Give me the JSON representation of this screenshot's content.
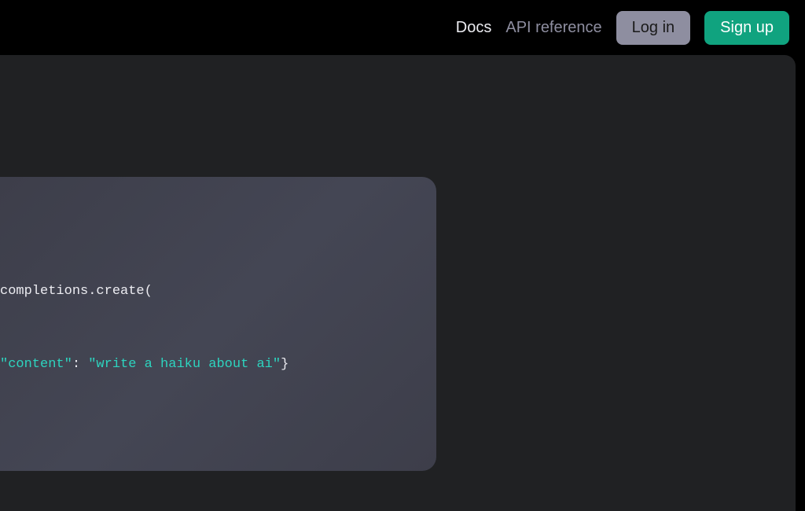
{
  "header": {
    "nav": {
      "docs": "Docs",
      "api_reference": "API reference"
    },
    "login_label": "Log in",
    "signup_label": "Sign up"
  },
  "code": {
    "line1_text": "completions.create(",
    "line2_str1": "\"content\"",
    "line2_colon": ": ",
    "line2_str2": "\"write a haiku about ai\"",
    "line2_close": "}"
  },
  "colors": {
    "accent": "#10a37f",
    "string": "#2dd4bf",
    "bg_main": "#202123",
    "bg_panel": "#444654"
  }
}
